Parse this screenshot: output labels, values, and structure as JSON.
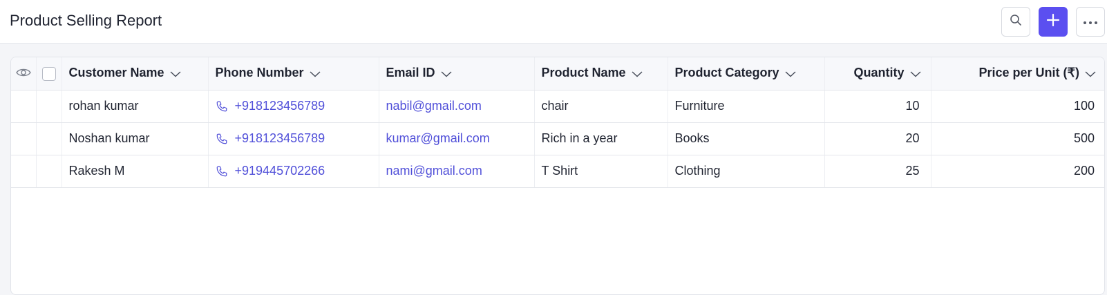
{
  "header": {
    "title": "Product Selling Report"
  },
  "toolbar": {
    "search_icon": "search-icon",
    "add_icon": "plus-icon",
    "more_icon": "more-horizontal-icon",
    "accent": "#5b4ff0"
  },
  "table": {
    "columns": [
      "Customer Name",
      "Phone Number",
      "Email ID",
      "Product Name",
      "Product Category",
      "Quantity",
      "Price per Unit (₹)"
    ],
    "rows": [
      {
        "customer": "rohan kumar",
        "phone": "+918123456789",
        "email": "nabil@gmail.com",
        "product": "chair",
        "category": "Furniture",
        "quantity": "10",
        "price": "100"
      },
      {
        "customer": "Noshan kumar",
        "phone": "+918123456789",
        "email": "kumar@gmail.com",
        "product": "Rich in a year",
        "category": "Books",
        "quantity": "20",
        "price": "500"
      },
      {
        "customer": "Rakesh M",
        "phone": "+919445702266",
        "email": "nami@gmail.com",
        "product": "T Shirt",
        "category": "Clothing",
        "quantity": "25",
        "price": "200"
      }
    ]
  }
}
